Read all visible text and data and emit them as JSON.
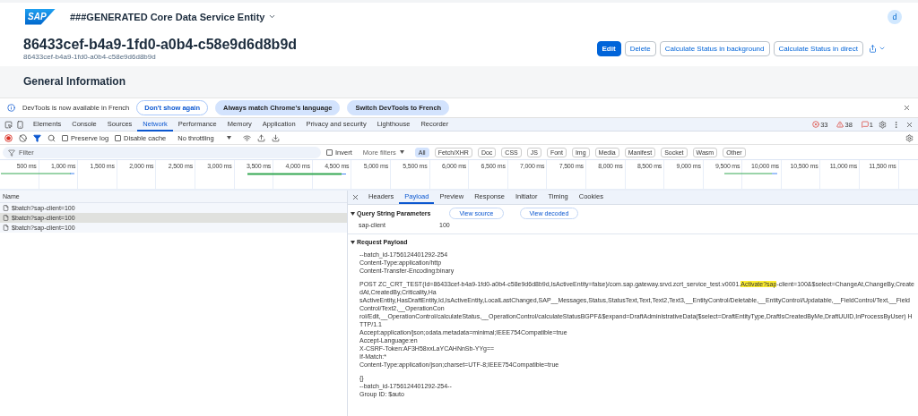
{
  "app_header": {
    "logo": "SAP",
    "title": "###GENERATED Core Data Service Entity",
    "avatar": "d"
  },
  "object": {
    "title": "86433cef-b4a9-1fd0-a0b4-c58e9d6d8b9d",
    "subtitle": "86433cef-b4a9-1fd0-a0b4-c58e9d6d8b9d",
    "actions": [
      {
        "label": "Edit",
        "primary": true
      },
      {
        "label": "Delete",
        "primary": false
      },
      {
        "label": "Calculate Status in background",
        "primary": false
      },
      {
        "label": "Calculate Status in direct",
        "primary": false
      }
    ]
  },
  "section_title": "General Information",
  "infobar": {
    "message": "DevTools is now available in French",
    "buttons": [
      {
        "label": "Don't show again",
        "kind": "outline"
      },
      {
        "label": "Always match Chrome's language",
        "kind": "filled"
      },
      {
        "label": "Switch DevTools to French",
        "kind": "filled"
      }
    ]
  },
  "devtools_tabs": [
    {
      "label": "Elements",
      "selected": false
    },
    {
      "label": "Console",
      "selected": false
    },
    {
      "label": "Sources",
      "selected": false
    },
    {
      "label": "Network",
      "selected": true
    },
    {
      "label": "Performance",
      "selected": false
    },
    {
      "label": "Memory",
      "selected": false
    },
    {
      "label": "Application",
      "selected": false
    },
    {
      "label": "Privacy and security",
      "selected": false
    },
    {
      "label": "Lighthouse",
      "selected": false
    },
    {
      "label": "Recorder",
      "selected": false
    }
  ],
  "counts": {
    "errors": "33",
    "warnings": "38",
    "issues": "1"
  },
  "toolbar": {
    "preserve_log": {
      "label": "Preserve log",
      "checked": false
    },
    "disable_cache": {
      "label": "Disable cache",
      "checked": false
    },
    "throttling": "No throttling"
  },
  "filter": {
    "placeholder": "Filter",
    "invert": {
      "label": "Invert",
      "checked": false
    },
    "more_filters": "More filters",
    "types": [
      {
        "label": "All",
        "selected": true
      },
      {
        "label": "Fetch/XHR",
        "selected": false
      },
      {
        "label": "Doc",
        "selected": false
      },
      {
        "label": "CSS",
        "selected": false
      },
      {
        "label": "JS",
        "selected": false
      },
      {
        "label": "Font",
        "selected": false
      },
      {
        "label": "Img",
        "selected": false
      },
      {
        "label": "Media",
        "selected": false
      },
      {
        "label": "Manifest",
        "selected": false
      },
      {
        "label": "Socket",
        "selected": false
      },
      {
        "label": "Wasm",
        "selected": false
      },
      {
        "label": "Other",
        "selected": false
      }
    ]
  },
  "timeline_ticks": [
    "500 ms",
    "1,000 ms",
    "1,500 ms",
    "2,000 ms",
    "2,500 ms",
    "3,000 ms",
    "3,500 ms",
    "4,000 ms",
    "4,500 ms",
    "5,000 ms",
    "5,500 ms",
    "6,000 ms",
    "6,500 ms",
    "7,000 ms",
    "7,500 ms",
    "8,000 ms",
    "8,500 ms",
    "9,000 ms",
    "9,500 ms",
    "10,000 ms",
    "10,500 ms",
    "11,000 ms",
    "11,500 ms"
  ],
  "requests": {
    "column": "Name",
    "rows": [
      {
        "name": "$batch?sap-client=100",
        "selected": false
      },
      {
        "name": "$batch?sap-client=100",
        "selected": true
      },
      {
        "name": "$batch?sap-client=100",
        "selected": false
      }
    ]
  },
  "detail_tabs": [
    {
      "label": "Headers",
      "selected": false
    },
    {
      "label": "Payload",
      "selected": true
    },
    {
      "label": "Preview",
      "selected": false
    },
    {
      "label": "Response",
      "selected": false
    },
    {
      "label": "Initiator",
      "selected": false
    },
    {
      "label": "Timing",
      "selected": false
    },
    {
      "label": "Cookies",
      "selected": false
    }
  ],
  "query_params": {
    "title": "Query String Parameters",
    "buttons": [
      "View source",
      "View decoded"
    ],
    "rows": [
      {
        "name": "sap-client",
        "value": "100"
      }
    ]
  },
  "payload": {
    "title": "Request Payload",
    "blocks": [
      [
        "--batch_id-1756124401292-254",
        "Content-Type:application/http",
        "Content-Transfer-Encoding:binary"
      ],
      [
        {
          "segments": [
            {
              "text": "POST ZC_CRT_TEST(Id=86433cef-b4a9-1fd0-a0b4-c58e9d6d8b9d,IsActiveEntity=false)/com.sap.gateway.srvd.zcrt_service_test.v0001.",
              "highlighted": false
            },
            {
              "text": "Activate?sap",
              "highlighted": true
            },
            {
              "text": "-client=100&$select=ChangeAt,ChangeBy,CreatedAt,CreatedBy,Criticality,Ha",
              "highlighted": false
            }
          ]
        },
        "sActiveEntity,HasDraftEntity,Id,IsActiveEntity,LocalLastChanged,SAP__Messages,Status,StatusText,Text,Text2,Text3,__EntityControl/Deletable,__EntityControl/Updatable,__FieldControl/Text,__FieldControl/Text2,__OperationCon",
        "rol/Edit,__OperationControl/calculateStatus,__OperationControl/calculateStatusBGPF&$expand=DraftAdministrativeData($select=DraftEntityType,DraftIsCreatedByMe,DraftUUID,InProcessByUser) HTTP/1.1",
        "Accept:application/json;odata.metadata=minimal;IEEE754Compatible=true",
        "Accept-Language:en",
        "X-CSRF-Token:AF3H58xxLaYCAHNnSb-YYg==",
        "If-Match:*",
        "Content-Type:application/json;charset=UTF-8;IEEE754Compatible=true"
      ],
      [
        "{}",
        "--batch_id-1756124401292-254--",
        "Group ID: $auto"
      ]
    ]
  }
}
